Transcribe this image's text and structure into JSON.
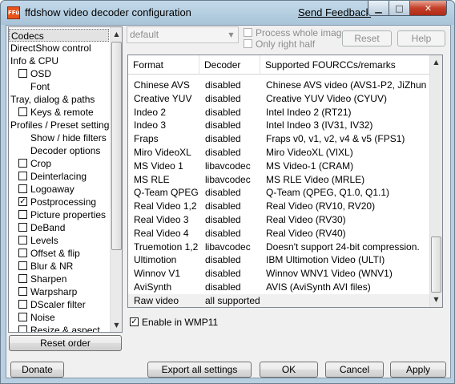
{
  "window": {
    "title": "ffdshow video decoder configuration",
    "icon_text": "FFü",
    "send_feedback": "Send Feedback",
    "minimize_glyph": "▁",
    "maximize_glyph": "□",
    "close_glyph": "✕"
  },
  "nav": {
    "items": [
      {
        "label": "Codecs",
        "indent": 0,
        "checkbox": false,
        "checked": false,
        "selected": true
      },
      {
        "label": "DirectShow control",
        "indent": 0,
        "checkbox": false,
        "checked": false,
        "selected": false
      },
      {
        "label": "Info & CPU",
        "indent": 0,
        "checkbox": false,
        "checked": false,
        "selected": false
      },
      {
        "label": "OSD",
        "indent": 1,
        "checkbox": true,
        "checked": false,
        "selected": false
      },
      {
        "label": "Font",
        "indent": 1,
        "checkbox": false,
        "checked": false,
        "selected": false
      },
      {
        "label": "Tray, dialog & paths",
        "indent": 0,
        "checkbox": false,
        "checked": false,
        "selected": false
      },
      {
        "label": "Keys & remote",
        "indent": 1,
        "checkbox": true,
        "checked": false,
        "selected": false
      },
      {
        "label": "Profiles / Preset settings",
        "indent": 0,
        "checkbox": false,
        "checked": false,
        "selected": false
      },
      {
        "label": "Show / hide filters",
        "indent": 1,
        "checkbox": false,
        "checked": false,
        "selected": false
      },
      {
        "label": "Decoder options",
        "indent": 1,
        "checkbox": false,
        "checked": false,
        "selected": false
      },
      {
        "label": "Crop",
        "indent": 1,
        "checkbox": true,
        "checked": false,
        "selected": false
      },
      {
        "label": "Deinterlacing",
        "indent": 1,
        "checkbox": true,
        "checked": false,
        "selected": false
      },
      {
        "label": "Logoaway",
        "indent": 1,
        "checkbox": true,
        "checked": false,
        "selected": false
      },
      {
        "label": "Postprocessing",
        "indent": 1,
        "checkbox": true,
        "checked": true,
        "selected": false
      },
      {
        "label": "Picture properties",
        "indent": 1,
        "checkbox": true,
        "checked": false,
        "selected": false
      },
      {
        "label": "DeBand",
        "indent": 1,
        "checkbox": true,
        "checked": false,
        "selected": false
      },
      {
        "label": "Levels",
        "indent": 1,
        "checkbox": true,
        "checked": false,
        "selected": false
      },
      {
        "label": "Offset & flip",
        "indent": 1,
        "checkbox": true,
        "checked": false,
        "selected": false
      },
      {
        "label": "Blur & NR",
        "indent": 1,
        "checkbox": true,
        "checked": false,
        "selected": false
      },
      {
        "label": "Sharpen",
        "indent": 1,
        "checkbox": true,
        "checked": false,
        "selected": false
      },
      {
        "label": "Warpsharp",
        "indent": 1,
        "checkbox": true,
        "checked": false,
        "selected": false
      },
      {
        "label": "DScaler filter",
        "indent": 1,
        "checkbox": true,
        "checked": false,
        "selected": false
      },
      {
        "label": "Noise",
        "indent": 1,
        "checkbox": true,
        "checked": false,
        "selected": false
      },
      {
        "label": "Resize & aspect",
        "indent": 1,
        "checkbox": true,
        "checked": false,
        "selected": false
      }
    ],
    "scroll_up_glyph": "▲",
    "scroll_down_glyph": "▼",
    "check_glyph": "✓"
  },
  "reset_order_label": "Reset order",
  "preset": {
    "value": "default",
    "arrow": "▼"
  },
  "options": {
    "process_whole_image": "Process whole image",
    "only_right_half": "Only right half",
    "reset_label": "Reset",
    "help_label": "Help"
  },
  "codecs": {
    "columns": [
      "Format",
      "Decoder",
      "Supported FOURCCs/remarks"
    ],
    "rows": [
      [
        "Chinese AVS",
        "disabled",
        "Chinese AVS video (AVS1-P2, JiZhun profile)"
      ],
      [
        "Creative YUV",
        "disabled",
        "Creative YUV Video (CYUV)"
      ],
      [
        "Indeo 2",
        "disabled",
        "Intel Indeo 2 (RT21)"
      ],
      [
        "Indeo 3",
        "disabled",
        "Intel Indeo 3 (IV31, IV32)"
      ],
      [
        "Fraps",
        "disabled",
        "Fraps v0, v1, v2, v4 & v5 (FPS1)"
      ],
      [
        "Miro VideoXL",
        "disabled",
        "Miro VideoXL (VIXL)"
      ],
      [
        "MS Video 1",
        "libavcodec",
        "MS Video-1 (CRAM)"
      ],
      [
        "MS RLE",
        "libavcodec",
        "MS RLE Video (MRLE)"
      ],
      [
        "Q-Team QPEG",
        "disabled",
        "Q-Team (QPEG, Q1.0, Q1.1)"
      ],
      [
        "Real Video 1,2",
        "disabled",
        "Real Video (RV10, RV20)"
      ],
      [
        "Real Video 3",
        "disabled",
        "Real Video (RV30)"
      ],
      [
        "Real Video 4",
        "disabled",
        "Real Video (RV40)"
      ],
      [
        "Truemotion 1,2",
        "libavcodec",
        "Doesn't support 24-bit compression."
      ],
      [
        "Ultimotion",
        "disabled",
        "IBM Ultimotion Video (ULTI)"
      ],
      [
        "Winnov V1",
        "disabled",
        "Winnov WNV1 Video (WNV1)"
      ],
      [
        "AviSynth",
        "disabled",
        "AVIS (AviSynth AVI files)"
      ],
      [
        "Raw video",
        "all supported",
        ""
      ]
    ],
    "scroll_up_glyph": "▲",
    "scroll_down_glyph": "▼"
  },
  "enable_wmp11": {
    "label": "Enable in WMP11",
    "checked": true
  },
  "footer": {
    "donate": "Donate",
    "export_all": "Export all settings",
    "ok": "OK",
    "cancel": "Cancel",
    "apply": "Apply"
  }
}
